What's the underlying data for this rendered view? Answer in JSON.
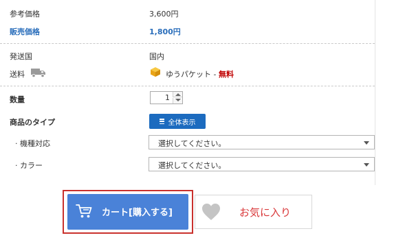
{
  "pricing": {
    "reference_label": "参考価格",
    "reference_value": "3,600円",
    "sale_label": "販売価格",
    "sale_value": "1,800円"
  },
  "shipping": {
    "origin_label": "発送国",
    "origin_value": "国内",
    "fee_label": "送料",
    "method": "ゆうパケット - ",
    "fee_value": "無料"
  },
  "quantity": {
    "label": "数量",
    "value": "1"
  },
  "product_type": {
    "label": "商品のタイプ",
    "show_all_label": "全体表示",
    "options": [
      {
        "label": "· 機種対応",
        "selected": "選択してください。"
      },
      {
        "label": "· カラー",
        "selected": "選択してください。"
      }
    ]
  },
  "actions": {
    "cart_label": "カート[購入する]",
    "favorite_label": "お気に入り"
  },
  "colors": {
    "accent_blue": "#2a6ebb",
    "cart_button": "#4a82d8",
    "show_all_button": "#1c6bbf",
    "free_red": "#c00000",
    "favorite_red": "#d9383a",
    "highlight_frame": "#c9302c"
  },
  "icons": {
    "shipping": "truck-icon",
    "parcel": "package-icon",
    "list": "list-icon",
    "cart": "cart-icon",
    "favorite": "heart-icon",
    "select": "chevron-down-icon",
    "stepper_up": "caret-up-icon",
    "stepper_down": "caret-down-icon"
  }
}
